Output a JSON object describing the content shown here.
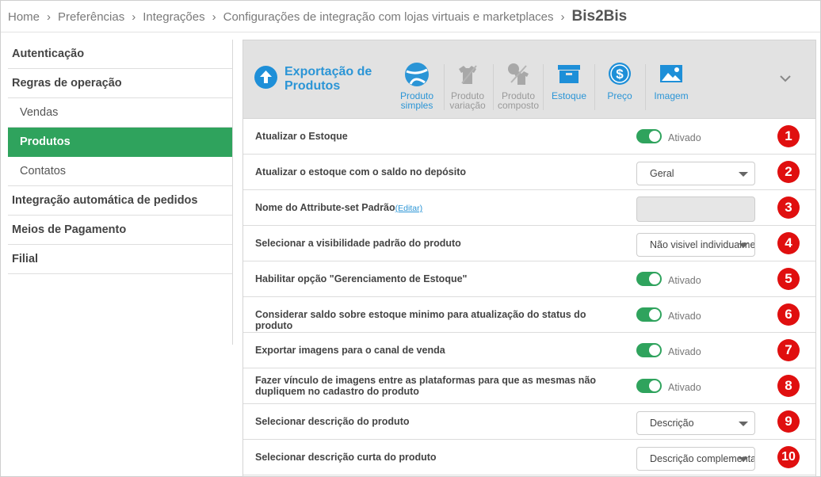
{
  "breadcrumb": {
    "items": [
      "Home",
      "Preferências",
      "Integrações",
      "Configurações de integração com lojas virtuais e marketplaces"
    ],
    "current": "Bis2Bis",
    "separator": "›"
  },
  "sidebar": {
    "items": [
      {
        "label": "Autenticação"
      },
      {
        "label": "Regras de operação"
      },
      {
        "label": "Vendas"
      },
      {
        "label": "Produtos"
      },
      {
        "label": "Contatos"
      },
      {
        "label": "Integração automática de pedidos"
      },
      {
        "label": "Meios de Pagamento"
      },
      {
        "label": "Filial"
      }
    ],
    "active": "Produtos"
  },
  "panel": {
    "title": "Exportação de Produtos",
    "toolbar": [
      {
        "label": "Produto simples",
        "icon": "ball-icon",
        "state": "active"
      },
      {
        "label": "Produto variação",
        "icon": "shirt-variation-icon",
        "state": "disabled"
      },
      {
        "label": "Produto composto",
        "icon": "shirt-composite-icon",
        "state": "disabled"
      },
      {
        "label": "Estoque",
        "icon": "box-icon",
        "state": "active"
      },
      {
        "label": "Preço",
        "icon": "dollar-icon",
        "state": "active"
      },
      {
        "label": "Imagem",
        "icon": "image-icon",
        "state": "active"
      }
    ],
    "colors": {
      "accent": "#2b95d6",
      "toggle_on": "#2fa35d",
      "badge": "#e00f0f",
      "header_bg": "#e2e2e2"
    }
  },
  "rows": [
    {
      "n": "1",
      "label": "Atualizar o Estoque",
      "control": "toggle",
      "value": "Ativado"
    },
    {
      "n": "2",
      "label": "Atualizar o estoque com o saldo no depósito",
      "control": "select",
      "value": "Geral"
    },
    {
      "n": "3",
      "label": "Nome do Attribute-set Padrão",
      "edit": "(Editar)",
      "control": "input-disabled",
      "value": ""
    },
    {
      "n": "4",
      "label": "Selecionar a visibilidade padrão do produto",
      "control": "select",
      "value": "Não visivel individualmente"
    },
    {
      "n": "5",
      "label": "Habilitar opção \"Gerenciamento de Estoque\"",
      "control": "toggle",
      "value": "Ativado"
    },
    {
      "n": "6",
      "label": "Considerar saldo sobre estoque minimo para atualização do status do produto",
      "control": "toggle",
      "value": "Ativado"
    },
    {
      "n": "7",
      "label": "Exportar imagens para o canal de venda",
      "control": "toggle",
      "value": "Ativado"
    },
    {
      "n": "8",
      "label": "Fazer vínculo de imagens entre as plataformas para que as mesmas não dupliquem no cadastro do produto",
      "control": "toggle",
      "value": "Ativado"
    },
    {
      "n": "9",
      "label": "Selecionar descrição do produto",
      "control": "select",
      "value": "Descrição"
    },
    {
      "n": "10",
      "label": "Selecionar descrição curta do produto",
      "control": "select",
      "value": "Descrição complementar"
    }
  ]
}
